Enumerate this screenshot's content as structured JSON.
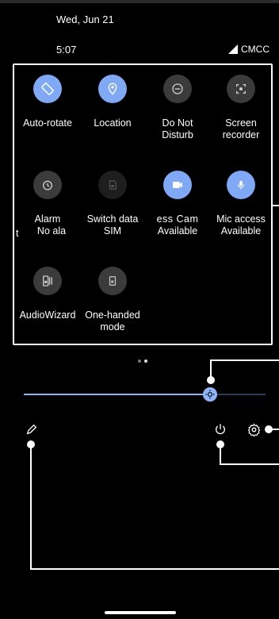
{
  "status": {
    "date": "Wed, Jun 21",
    "time": "5:07",
    "carrier": "CMCC"
  },
  "tiles": [
    {
      "label": "Auto-rotate",
      "icon": "rotate-icon",
      "state": "on"
    },
    {
      "label": "Location",
      "icon": "location-icon",
      "state": "on"
    },
    {
      "label": "Do Not Disturb",
      "icon": "dnd-icon",
      "state": "off"
    },
    {
      "label": "Screen recorder",
      "icon": "screen-record-icon",
      "state": "off"
    },
    {
      "label": "Alarm",
      "icon": "alarm-icon",
      "state": "off"
    },
    {
      "label": "Switch data SIM",
      "icon": "sim-icon",
      "state": "unavailable"
    },
    {
      "label": "ess Cam",
      "icon": "camera-icon",
      "state": "on"
    },
    {
      "label": "Mic access",
      "icon": "mic-icon",
      "state": "on"
    },
    {
      "label": "AudioWizard",
      "icon": "audio-wizard-icon",
      "state": "off"
    },
    {
      "label": "One-handed mode",
      "icon": "one-handed-icon",
      "state": "off"
    }
  ],
  "sublabels": {
    "alarm_left": "t",
    "alarm": "No ala",
    "camera": "Available",
    "mic": "Available"
  },
  "page_indicator": {
    "pages": 2,
    "current": 2
  },
  "brightness": {
    "level": 0.77
  },
  "colors": {
    "accent": "#7fa9f5",
    "panel_bg": "#000000"
  }
}
